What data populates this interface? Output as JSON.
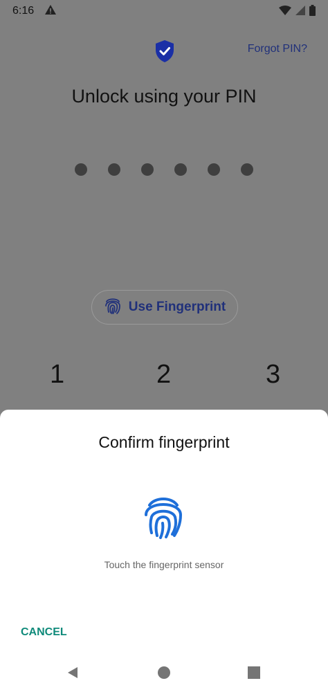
{
  "status_bar": {
    "time": "6:16"
  },
  "header": {
    "forgot_pin": "Forgot PIN?",
    "title": "Unlock using your PIN"
  },
  "pin": {
    "dot_count": 6
  },
  "fingerprint_button": {
    "label": "Use Fingerprint"
  },
  "keypad": {
    "row1": [
      "1",
      "2",
      "3"
    ]
  },
  "sheet": {
    "title": "Confirm fingerprint",
    "hint": "Touch the fingerprint sensor",
    "cancel": "CANCEL"
  },
  "colors": {
    "accent_blue": "#1e6fd9",
    "link_blue": "#20307a",
    "cancel_teal": "#0f8a7a",
    "shield_blue": "#1a2fa6"
  },
  "icons": {
    "status": [
      "warning-icon",
      "wifi-icon",
      "signal-icon",
      "battery-icon"
    ],
    "shield": "shield-check-icon",
    "fingerprint": "fingerprint-icon",
    "nav": [
      "back-icon",
      "home-icon",
      "recents-icon"
    ]
  }
}
